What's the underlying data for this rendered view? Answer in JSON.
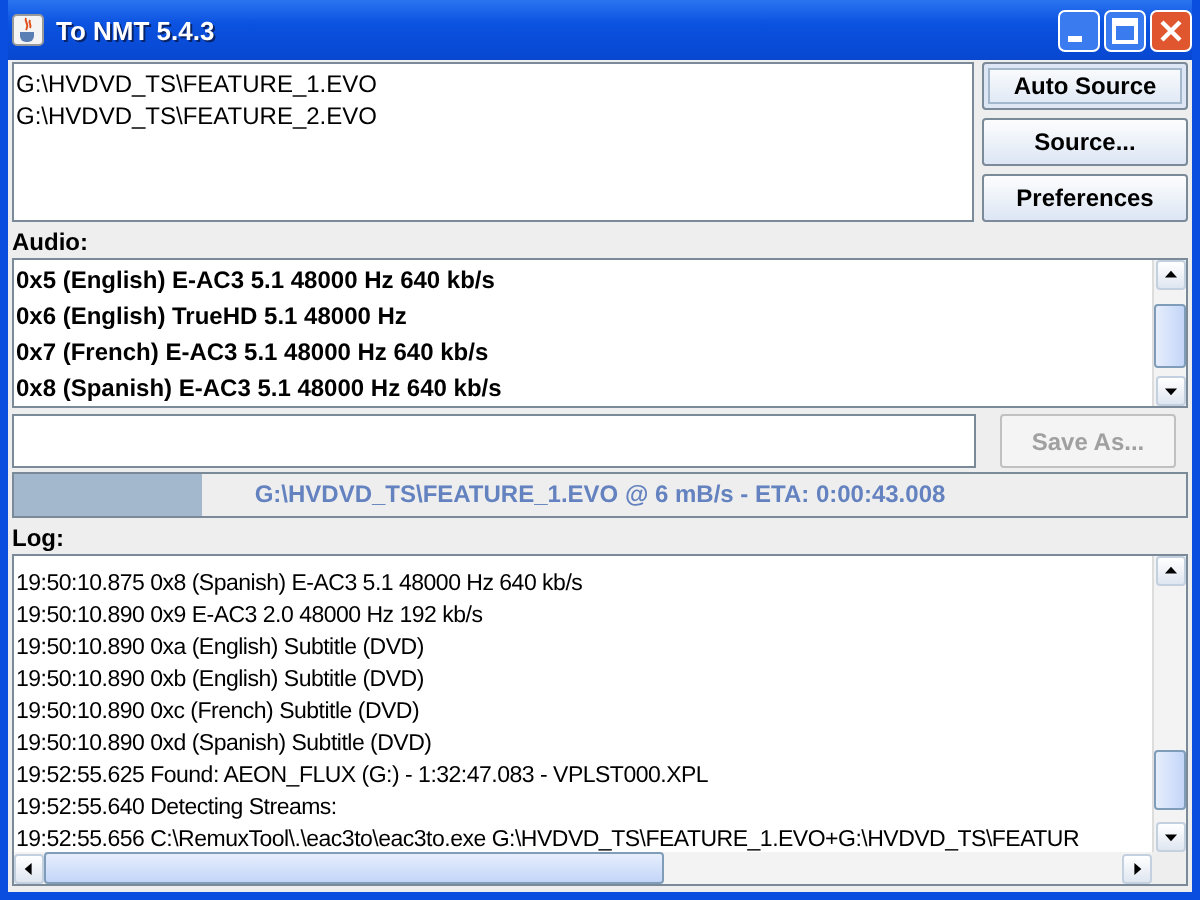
{
  "window": {
    "title": "To NMT 5.4.3"
  },
  "sources": [
    "G:\\HVDVD_TS\\FEATURE_1.EVO",
    "G:\\HVDVD_TS\\FEATURE_2.EVO"
  ],
  "buttons": [
    {
      "label": "Auto Source",
      "focused": true
    },
    {
      "label": "Source...",
      "focused": false
    },
    {
      "label": "Preferences",
      "focused": false
    }
  ],
  "audio": {
    "label": "Audio:",
    "items": [
      "0x5 (English) E-AC3 5.1 48000 Hz 640 kb/s",
      "0x6 (English) TrueHD 5.1 48000 Hz",
      "0x7 (French) E-AC3 5.1 48000 Hz 640 kb/s",
      "0x8 (Spanish) E-AC3 5.1 48000 Hz 640 kb/s"
    ]
  },
  "save_as": {
    "label": "Save As...",
    "disabled": true
  },
  "progress": {
    "level": 0.16,
    "text": "G:\\HVDVD_TS\\FEATURE_1.EVO @ 6 mB/s - ETA: 0:00:43.008"
  },
  "log": {
    "label": "Log:",
    "lines": [
      "19:50:10.875 0x8 (Spanish) E-AC3 5.1 48000 Hz 640 kb/s",
      "19:50:10.890 0x9 E-AC3 2.0 48000 Hz 192 kb/s",
      "19:50:10.890 0xa (English) Subtitle (DVD)",
      "19:50:10.890 0xb (English) Subtitle (DVD)",
      "19:50:10.890 0xc (French) Subtitle (DVD)",
      "19:50:10.890 0xd (Spanish) Subtitle (DVD)",
      "19:52:55.625 Found: AEON_FLUX (G:) - 1:32:47.083 - VPLST000.XPL",
      "19:52:55.640 Detecting Streams:",
      "19:52:55.656 C:\\RemuxTool\\.\\eac3to\\eac3to.exe G:\\HVDVD_TS\\FEATURE_1.EVO+G:\\HVDVD_TS\\FEATUR"
    ]
  }
}
